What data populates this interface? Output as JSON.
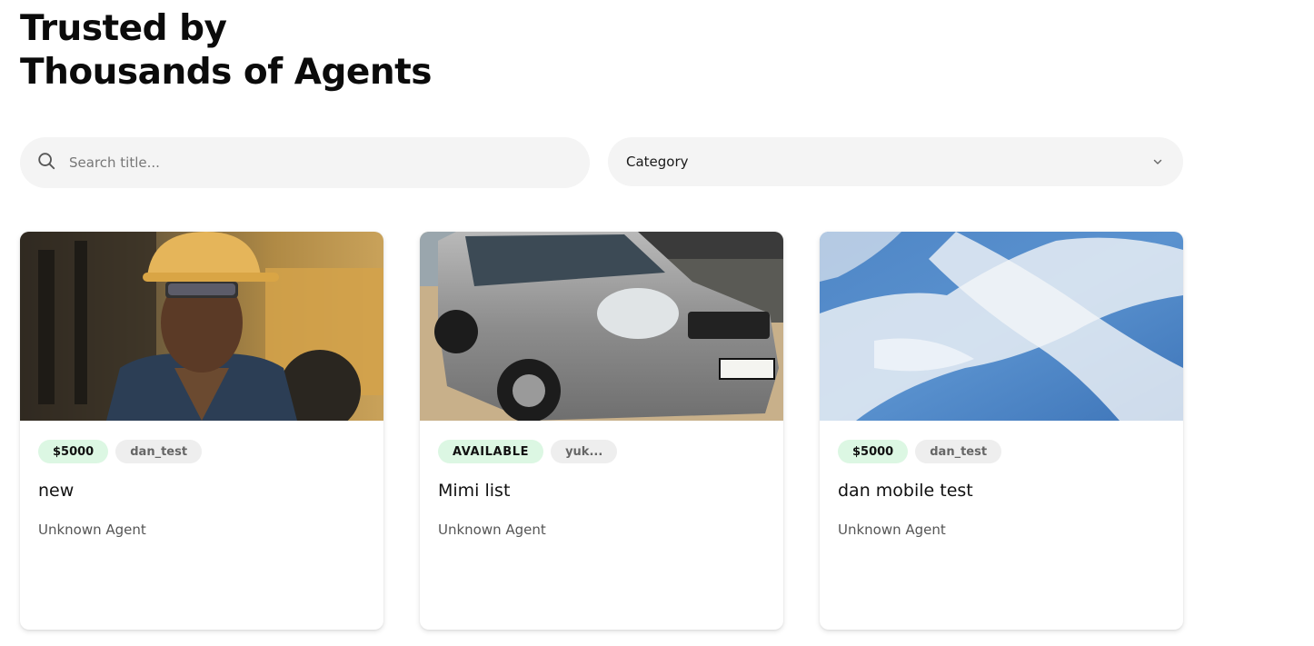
{
  "heading": {
    "line1": "Trusted by",
    "line2": "Thousands of Agents"
  },
  "search": {
    "placeholder": "Search title...",
    "icon": "search-icon"
  },
  "category": {
    "label": "Category",
    "icon": "chevron-down-icon"
  },
  "colors": {
    "chip_green": "#dcf7e3",
    "chip_gray": "#eeeeee",
    "field_bg": "#f4f4f4"
  },
  "listings": [
    {
      "badge": "$5000",
      "user": "dan_test",
      "title": "new",
      "agent": "Unknown Agent",
      "image": "construction-worker-photo"
    },
    {
      "badge": "AVAILABLE",
      "user": "yuk...",
      "title": "Mimi list",
      "agent": "Unknown Agent",
      "image": "silver-suv-photo"
    },
    {
      "badge": "$5000",
      "user": "dan_test",
      "title": "dan mobile test",
      "agent": "Unknown Agent",
      "image": "blue-sky-clouds-photo"
    }
  ]
}
